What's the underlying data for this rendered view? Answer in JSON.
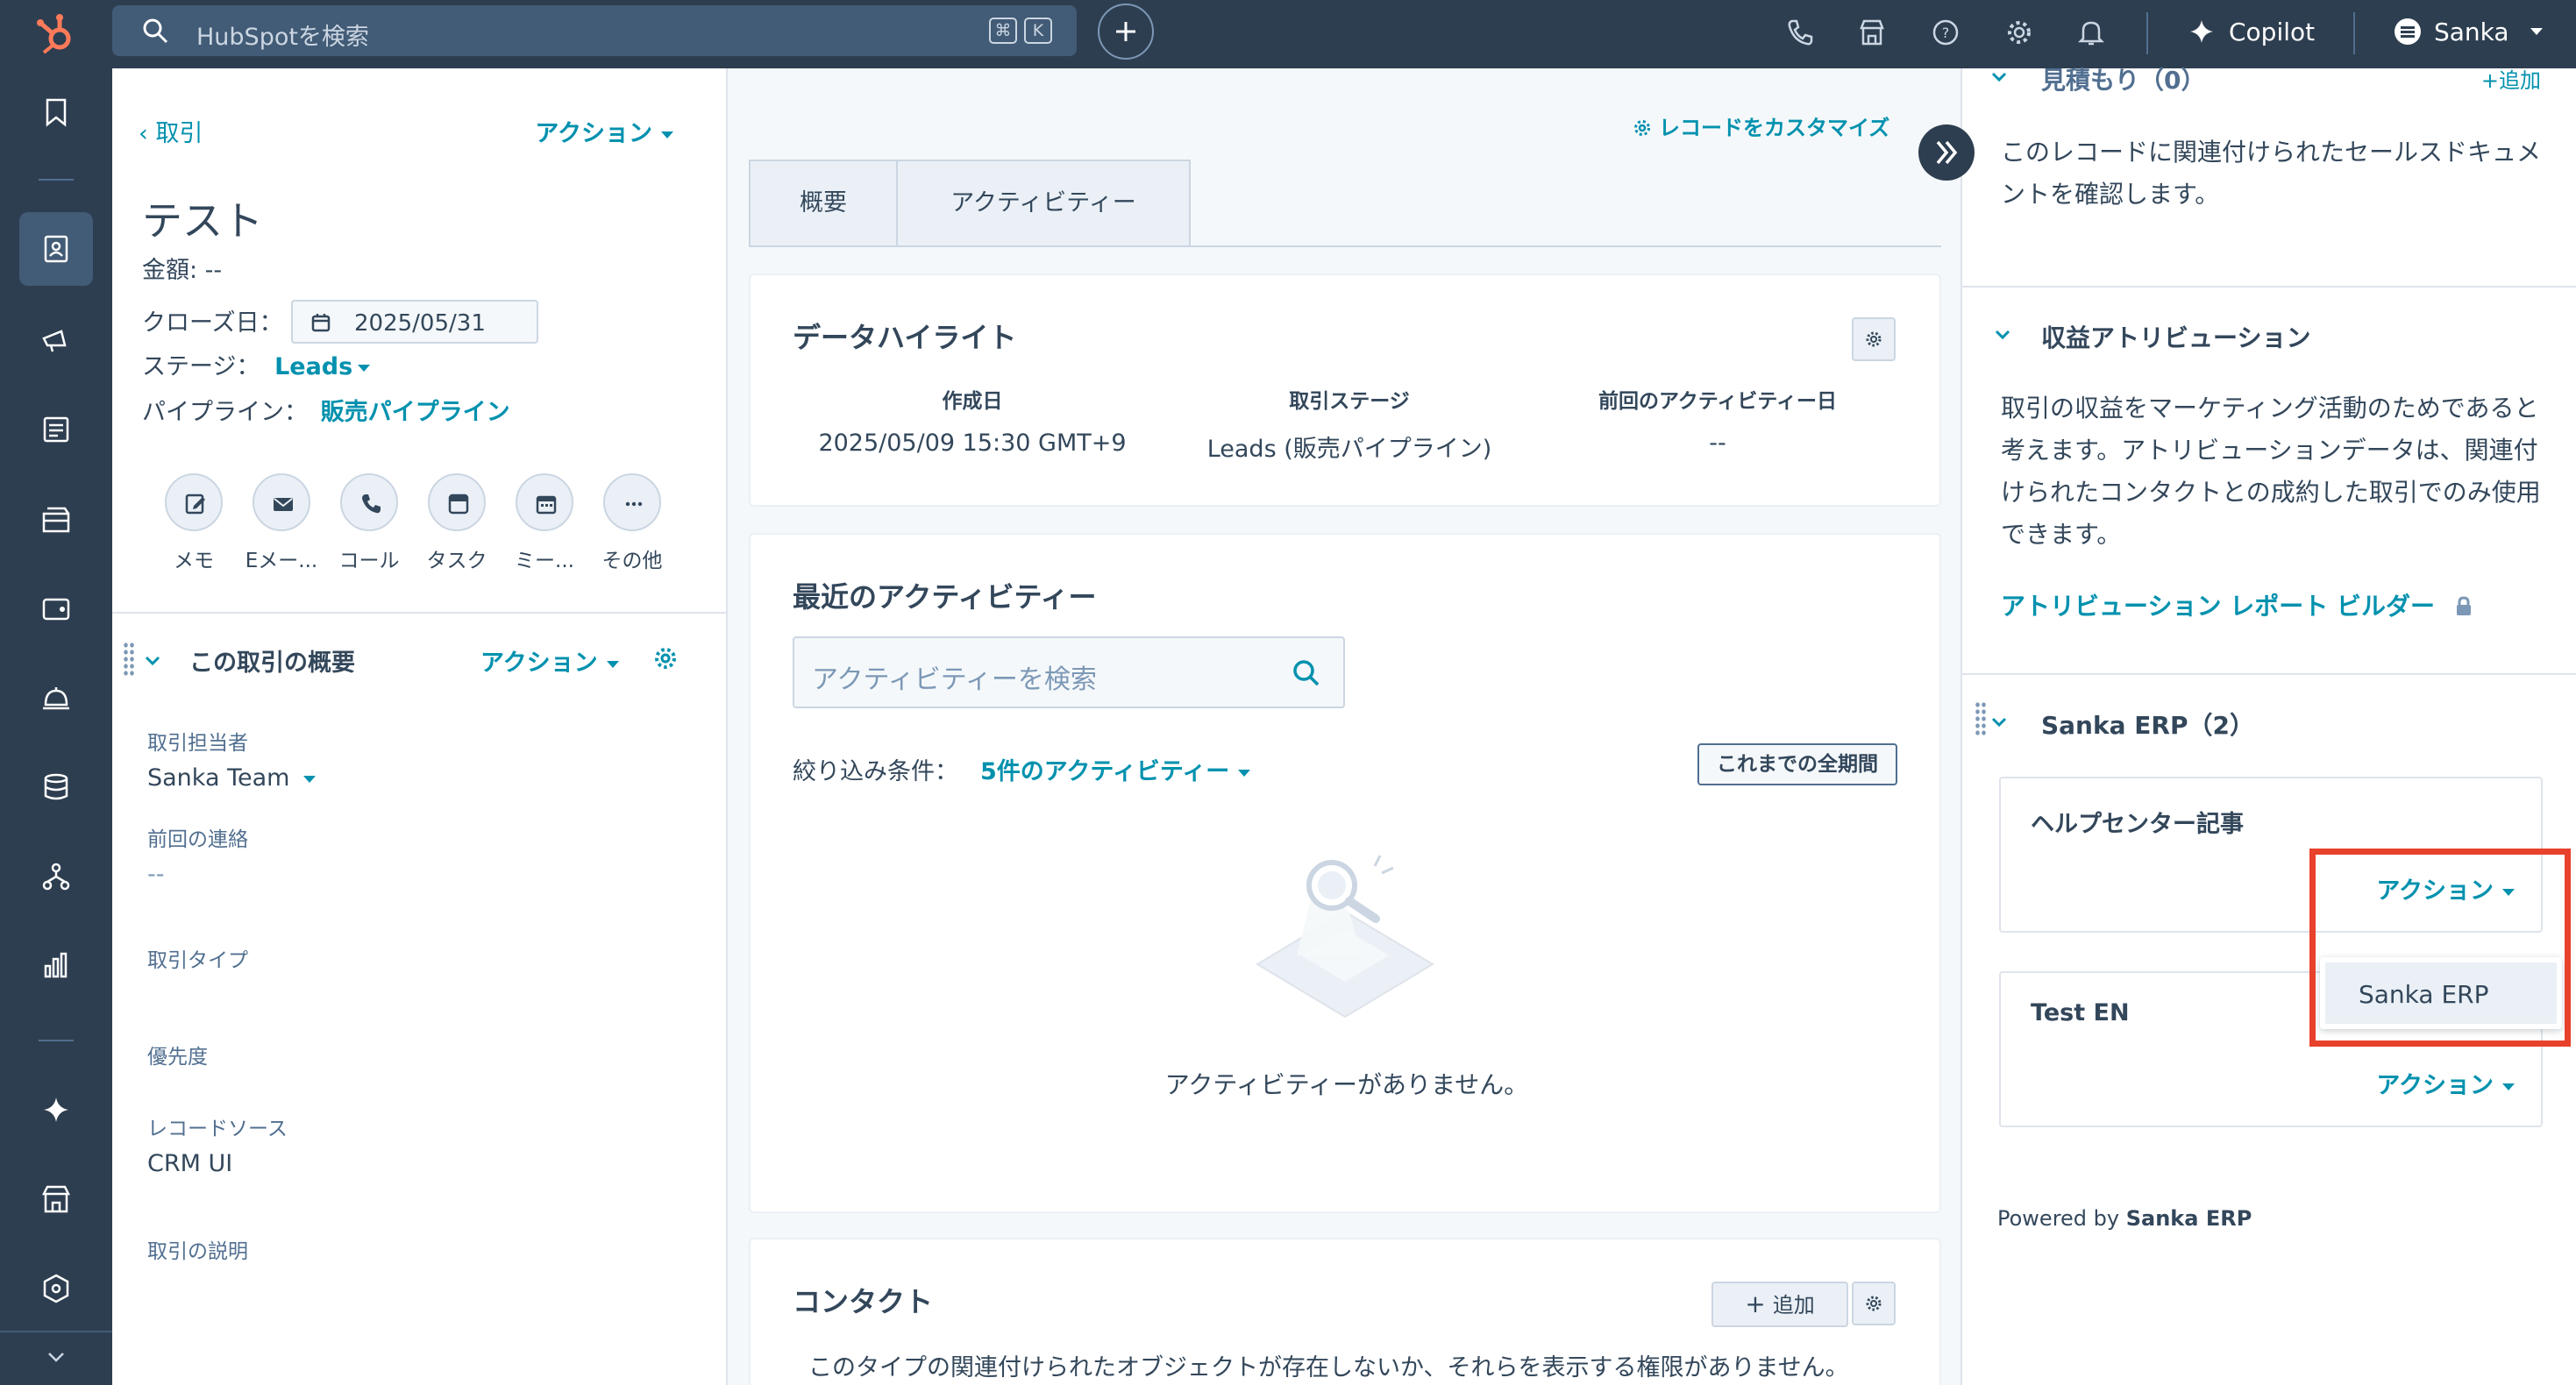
{
  "topbar": {
    "search_placeholder": "HubSpotを検索",
    "kbd_cmd": "⌘",
    "kbd_k": "K",
    "copilot_label": "Copilot",
    "user_name": "Sanka"
  },
  "left_panel": {
    "back_label": "取引",
    "action_label": "アクション",
    "record_title": "テスト",
    "amount_row": "金額: --",
    "close_date_label": "クローズ日：",
    "close_date_value": "2025/05/31",
    "stage_label": "ステージ：",
    "stage_value": "Leads",
    "pipeline_label": "パイプライン：",
    "pipeline_value": "販売パイプライン",
    "activity_buttons": [
      {
        "label": "メモ",
        "icon": "edit-icon"
      },
      {
        "label": "Eメー...",
        "icon": "email-icon"
      },
      {
        "label": "コール",
        "icon": "phone-icon"
      },
      {
        "label": "タスク",
        "icon": "task-icon"
      },
      {
        "label": "ミー...",
        "icon": "calendar-icon"
      },
      {
        "label": "その他",
        "icon": "more-icon"
      }
    ],
    "about_title": "この取引の概要",
    "about_action": "アクション",
    "properties": [
      {
        "label": "取引担当者",
        "value": "Sanka Team"
      },
      {
        "label": "前回の連絡",
        "value": "--"
      },
      {
        "label": "取引タイプ",
        "value": ""
      },
      {
        "label": "優先度",
        "value": ""
      },
      {
        "label": "レコードソース",
        "value": "CRM UI"
      },
      {
        "label": "取引の説明",
        "value": ""
      }
    ]
  },
  "center": {
    "customize_label": "レコードをカスタマイズ",
    "tabs": [
      {
        "label": "概要",
        "active": true
      },
      {
        "label": "アクティビティー",
        "active": false
      }
    ],
    "highlights": {
      "title": "データハイライト",
      "columns": [
        {
          "label": "作成日",
          "value": "2025/05/09 15:30 GMT+9"
        },
        {
          "label": "取引ステージ",
          "value": "Leads (販売パイプライン)"
        },
        {
          "label": "前回のアクティビティー日",
          "value": "--"
        }
      ]
    },
    "activity": {
      "title": "最近のアクティビティー",
      "search_placeholder": "アクティビティーを検索",
      "filter_label": "絞り込み条件：",
      "filter_value": "5件のアクティビティー",
      "period_button": "これまでの全期間",
      "empty_text": "アクティビティーがありません。"
    },
    "contacts": {
      "title": "コンタクト",
      "add_label": "追加",
      "message": "このタイプの関連付けられたオブジェクトが存在しないか、それらを表示する権限がありません。"
    }
  },
  "right_panel": {
    "quotes_title": "見積もり（0）",
    "quotes_add": "+追加",
    "quotes_text_1": "このレコードに関連付けられたセールスドキュメ",
    "quotes_text_2": "ントを確認します。",
    "attribution_title": "収益アトリビューション",
    "attribution_lines": [
      "取引の収益をマーケティング活動のためであると",
      "考えます。アトリビューションデータは、関連付",
      "けられたコンタクトとの成約した取引でのみ使用",
      "できます。"
    ],
    "attribution_link": "アトリビューション レポート ビルダー",
    "erp_title": "Sanka ERP（2）",
    "erp_cards": [
      {
        "title": "ヘルプセンター記事",
        "action": "アクション"
      },
      {
        "title": "Test EN",
        "action": "アクション"
      }
    ],
    "dropdown_item": "Sanka ERP",
    "powered_prefix": "Powered by ",
    "powered_brand": "Sanka ERP"
  },
  "colors": {
    "nav_bg": "#2d3e50",
    "link": "#0091ae",
    "highlight_border": "#e8412c",
    "brand_orange": "#ff7a59"
  }
}
